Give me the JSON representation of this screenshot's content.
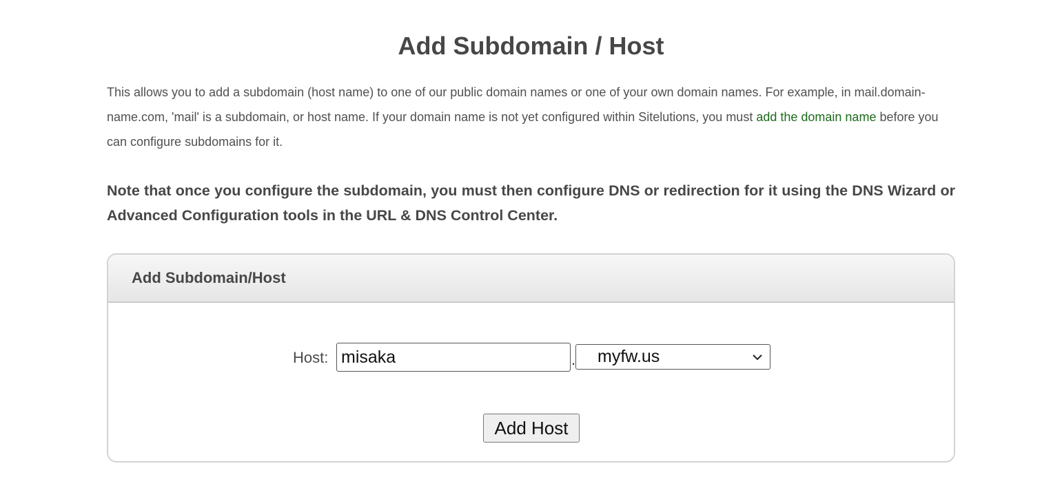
{
  "page": {
    "title": "Add Subdomain / Host"
  },
  "intro": {
    "text_before_link": "This allows you to add a subdomain (host name) to one of our public domain names or one of your own domain names. For example, in mail.domain-name.com, 'mail' is a subdomain, or host name. If your domain name is not yet configured within Sitelutions, you must ",
    "link_text": "add the domain name",
    "text_after_link": " before you can configure subdomains for it."
  },
  "note": {
    "text": "Note that once you configure the subdomain, you must then configure DNS or redirection for it using the DNS Wizard or Advanced Configuration tools in the URL & DNS Control Center."
  },
  "panel": {
    "title": "Add Subdomain/Host",
    "host_label": "Host:",
    "host_value": "misaka",
    "separator": ".",
    "domain_selected": "myfw.us",
    "submit_label": "Add Host"
  },
  "colors": {
    "link": "#1c6b1c",
    "text": "#4a4a4a"
  },
  "icons": {
    "dropdown": "chevron-down-icon"
  }
}
